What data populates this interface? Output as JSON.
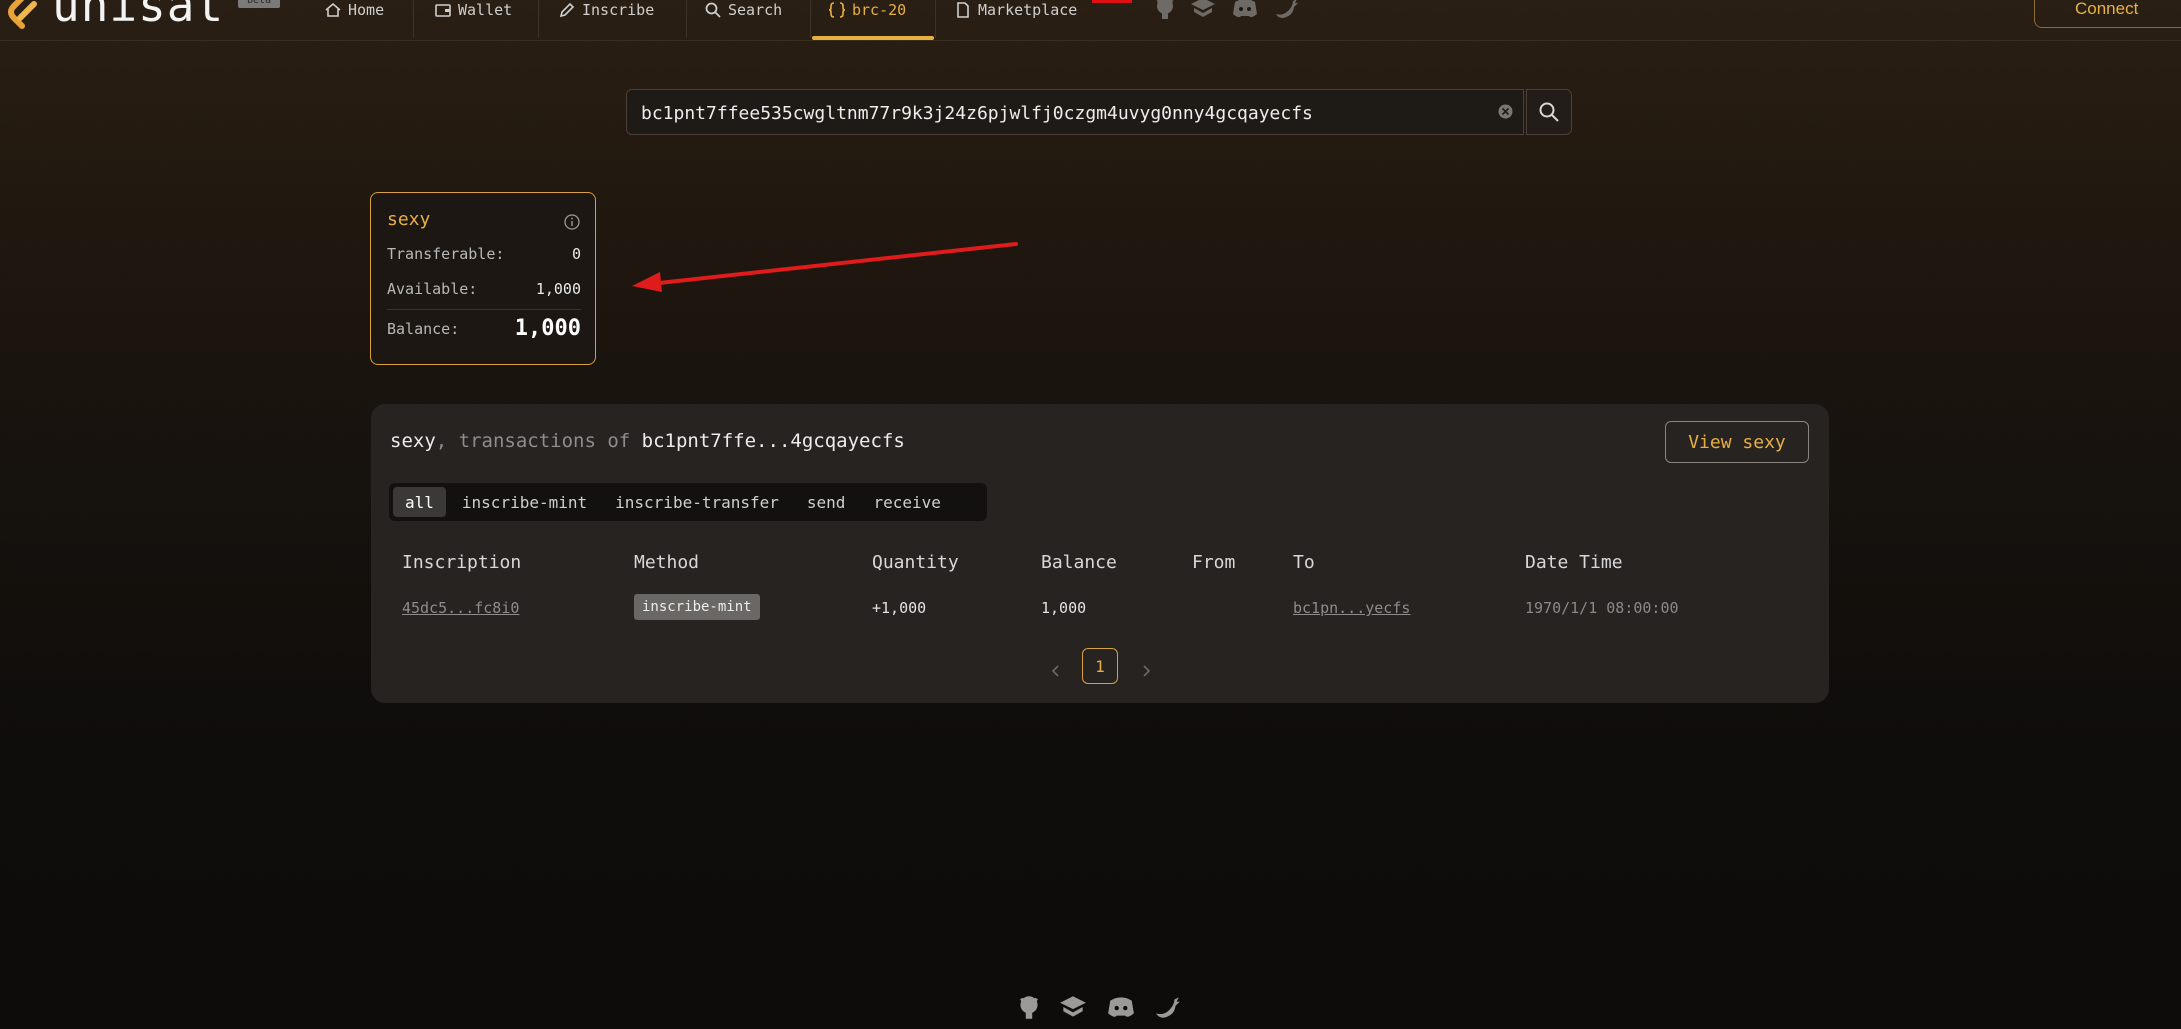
{
  "nav": {
    "brand": "unisat",
    "beta": "beta",
    "items": [
      {
        "label": "Home",
        "icon": "home-icon"
      },
      {
        "label": "Wallet",
        "icon": "wallet-icon"
      },
      {
        "label": "Inscribe",
        "icon": "pencil-icon"
      },
      {
        "label": "Search",
        "icon": "search-icon"
      },
      {
        "label": "brc-20",
        "icon": "braces-icon",
        "active": true
      },
      {
        "label": "Marketplace",
        "icon": "document-icon"
      }
    ],
    "social": [
      "github-icon",
      "docs-icon",
      "discord-icon",
      "twitter-icon"
    ],
    "connect_label": "Connect"
  },
  "search": {
    "value": "bc1pnt7ffee535cwgltnm77r9k3j24z6pjwlfj0czgm4uvyg0nny4gcqayecfs",
    "placeholder": ""
  },
  "token_card": {
    "ticker": "sexy",
    "transferable_label": "Transferable:",
    "transferable_value": "0",
    "available_label": "Available:",
    "available_value": "1,000",
    "balance_label": "Balance:",
    "balance_value": "1,000"
  },
  "transactions": {
    "ticker": "sexy",
    "title_sep": ", transactions of ",
    "address_short": "bc1pnt7ffe...4gcqayecfs",
    "view_button": "View sexy",
    "tabs": [
      {
        "label": "all",
        "active": true
      },
      {
        "label": "inscribe-mint",
        "active": false
      },
      {
        "label": "inscribe-transfer",
        "active": false
      },
      {
        "label": "send",
        "active": false
      },
      {
        "label": "receive",
        "active": false
      }
    ],
    "columns": [
      "Inscription",
      "Method",
      "Quantity",
      "Balance",
      "From",
      "To",
      "Date Time"
    ],
    "rows": [
      {
        "inscription": "45dc5...fc8i0",
        "method": "inscribe-mint",
        "quantity": "+1,000",
        "balance": "1,000",
        "from": "",
        "to": "bc1pn...yecfs",
        "datetime": "1970/1/1 08:00:00"
      }
    ],
    "pagination": {
      "current": "1"
    }
  },
  "footer": {
    "icons": [
      "github-icon",
      "docs-icon",
      "discord-icon",
      "twitter-icon"
    ]
  },
  "colors": {
    "accent": "#e8b043",
    "arrow": "#e01b1b"
  }
}
